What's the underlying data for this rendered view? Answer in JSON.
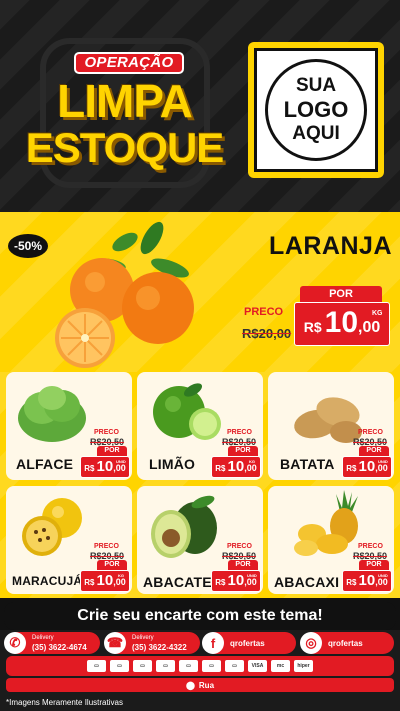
{
  "header": {
    "badge": "OPERAÇÃO",
    "title_line1": "LIMPA",
    "title_line2": "ESTOQUE",
    "logo": {
      "line1": "SUA",
      "line2": "LOGO",
      "line3": "AQUI"
    }
  },
  "hero": {
    "discount": "-50%",
    "product": "LARANJA",
    "preco_label": "PRECO",
    "old_price": "R$20,00",
    "por_label": "POR",
    "currency": "R$",
    "price_int": "10",
    "price_dec": ",00",
    "unit": "KG"
  },
  "products": [
    {
      "name": "ALFACE",
      "preco_label": "PRECO",
      "old_price": "R$20,50",
      "por_label": "POR",
      "currency": "R$",
      "price_int": "10",
      "price_dec": ",00",
      "unit": "UNID"
    },
    {
      "name": "LIMÃO",
      "preco_label": "PRECO",
      "old_price": "R$20,50",
      "por_label": "POR",
      "currency": "R$",
      "price_int": "10",
      "price_dec": ",00",
      "unit": "KG"
    },
    {
      "name": "BATATA",
      "preco_label": "PRECO",
      "old_price": "R$20,50",
      "por_label": "POR",
      "currency": "R$",
      "price_int": "10",
      "price_dec": ",00",
      "unit": "UNID"
    },
    {
      "name": "MARACUJÁ",
      "preco_label": "PRECO",
      "old_price": "R$20,50",
      "por_label": "POR",
      "currency": "R$",
      "price_int": "10",
      "price_dec": ",00",
      "unit": "KG"
    },
    {
      "name": "ABACATE",
      "preco_label": "PRECO",
      "old_price": "R$20,50",
      "por_label": "POR",
      "currency": "R$",
      "price_int": "10",
      "price_dec": ",00",
      "unit": "UNID"
    },
    {
      "name": "ABACAXI",
      "preco_label": "PRECO",
      "old_price": "R$20,50",
      "por_label": "POR",
      "currency": "R$",
      "price_int": "10",
      "price_dec": ",00",
      "unit": "UNID"
    }
  ],
  "cta": "Crie seu encarte com este tema!",
  "contacts": [
    {
      "icon": "whatsapp-icon",
      "label": "Delivery",
      "value": "(35) 3622-4674"
    },
    {
      "icon": "phone-icon",
      "label": "Delivery",
      "value": "(35) 3622-4322"
    },
    {
      "icon": "facebook-icon",
      "value": "qrofertas"
    },
    {
      "icon": "instagram-icon",
      "value": "qrofertas"
    }
  ],
  "payments": [
    "card",
    "card",
    "card",
    "card",
    "card",
    "card",
    "card",
    "VISA",
    "mc",
    "hiper"
  ],
  "address": "Rua",
  "disclaimer": "*Imagens Meramente Ilustrativas",
  "colors": {
    "accent_red": "#e21b23",
    "accent_yellow": "#ffd400",
    "dark": "#1b1b1b"
  }
}
